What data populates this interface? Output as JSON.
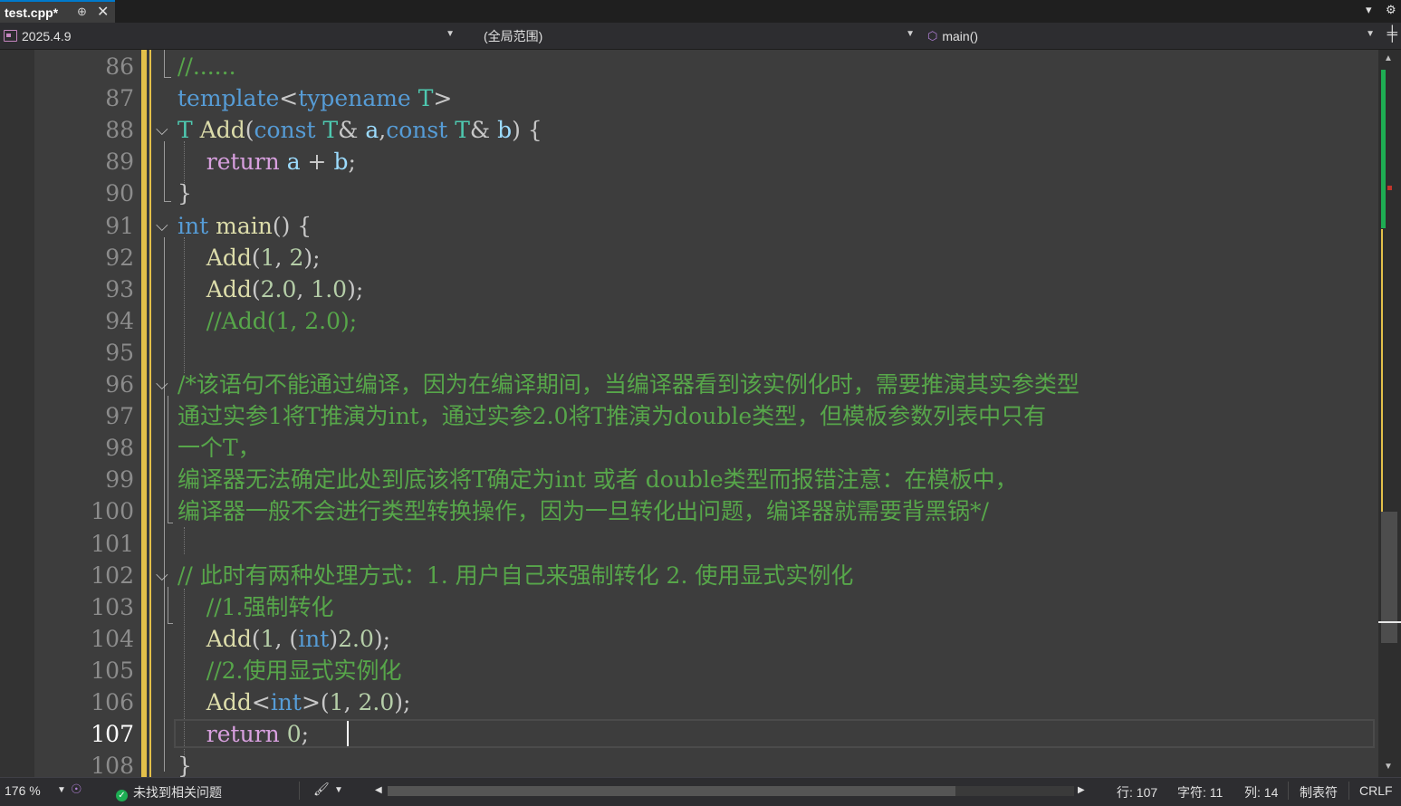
{
  "tab": {
    "title": "test.cpp*",
    "pin": "⊕",
    "close": "✕"
  },
  "navbar": {
    "project": "2025.4.9",
    "scope": "(全局范围)",
    "member": "main()"
  },
  "editor": {
    "current_line": 107,
    "lines": [
      {
        "n": "86",
        "t": [
          [
            "cmt",
            "//......"
          ]
        ]
      },
      {
        "n": "87",
        "t": [
          [
            "kw",
            "template"
          ],
          [
            "pl",
            "<"
          ],
          [
            "kw",
            "typename"
          ],
          [
            "pl",
            " "
          ],
          [
            "ty",
            "T"
          ],
          [
            "pl",
            ">"
          ]
        ]
      },
      {
        "n": "88",
        "fold": true,
        "t": [
          [
            "ty",
            "T"
          ],
          [
            "pl",
            " "
          ],
          [
            "fn",
            "Add"
          ],
          [
            "pl",
            "("
          ],
          [
            "kw",
            "const"
          ],
          [
            "pl",
            " "
          ],
          [
            "ty",
            "T"
          ],
          [
            "pl",
            "& "
          ],
          [
            "var",
            "a"
          ],
          [
            "pl",
            ","
          ],
          [
            "kw",
            "const"
          ],
          [
            "pl",
            " "
          ],
          [
            "ty",
            "T"
          ],
          [
            "pl",
            "& "
          ],
          [
            "var",
            "b"
          ],
          [
            "pl",
            ") {"
          ]
        ]
      },
      {
        "n": "89",
        "t": [
          [
            "pl",
            "    "
          ],
          [
            "ctl",
            "return"
          ],
          [
            "pl",
            " "
          ],
          [
            "var",
            "a"
          ],
          [
            "pl",
            " + "
          ],
          [
            "var",
            "b"
          ],
          [
            "pl",
            ";"
          ]
        ]
      },
      {
        "n": "90",
        "t": [
          [
            "pl",
            "}"
          ]
        ]
      },
      {
        "n": "91",
        "fold": true,
        "t": [
          [
            "kw",
            "int"
          ],
          [
            "pl",
            " "
          ],
          [
            "fn",
            "main"
          ],
          [
            "pl",
            "() {"
          ]
        ]
      },
      {
        "n": "92",
        "t": [
          [
            "pl",
            "    "
          ],
          [
            "fn",
            "Add"
          ],
          [
            "pl",
            "("
          ],
          [
            "num",
            "1"
          ],
          [
            "pl",
            ", "
          ],
          [
            "num",
            "2"
          ],
          [
            "pl",
            ");"
          ]
        ]
      },
      {
        "n": "93",
        "t": [
          [
            "pl",
            "    "
          ],
          [
            "fn",
            "Add"
          ],
          [
            "pl",
            "("
          ],
          [
            "num",
            "2.0"
          ],
          [
            "pl",
            ", "
          ],
          [
            "num",
            "1.0"
          ],
          [
            "pl",
            ");"
          ]
        ]
      },
      {
        "n": "94",
        "t": [
          [
            "pl",
            "    "
          ],
          [
            "cmt",
            "//Add(1, 2.0);"
          ]
        ]
      },
      {
        "n": "95",
        "t": []
      },
      {
        "n": "96",
        "fold": true,
        "t": [
          [
            "cmt",
            "/*该语句不能通过编译，因为在编译期间，当编译器看到该实例化时，需要推演其实参类型"
          ]
        ]
      },
      {
        "n": "97",
        "t": [
          [
            "cmt",
            "通过实参1将T推演为int，通过实参2.0将T推演为double类型，但模板参数列表中只有"
          ]
        ]
      },
      {
        "n": "98",
        "t": [
          [
            "cmt",
            "一个T，"
          ]
        ]
      },
      {
        "n": "99",
        "t": [
          [
            "cmt",
            "编译器无法确定此处到底该将T确定为int 或者 double类型而报错注意：在模板中，"
          ]
        ]
      },
      {
        "n": "100",
        "t": [
          [
            "cmt",
            "编译器一般不会进行类型转换操作，因为一旦转化出问题，编译器就需要背黑锅*/"
          ]
        ]
      },
      {
        "n": "101",
        "t": []
      },
      {
        "n": "102",
        "fold": true,
        "t": [
          [
            "cmt",
            "// 此时有两种处理方式：1. 用户自己来强制转化 2. 使用显式实例化"
          ]
        ]
      },
      {
        "n": "103",
        "t": [
          [
            "pl",
            "    "
          ],
          [
            "cmt",
            "//1.强制转化"
          ]
        ]
      },
      {
        "n": "104",
        "t": [
          [
            "pl",
            "    "
          ],
          [
            "fn",
            "Add"
          ],
          [
            "pl",
            "("
          ],
          [
            "num",
            "1"
          ],
          [
            "pl",
            ", ("
          ],
          [
            "kw",
            "int"
          ],
          [
            "pl",
            ")"
          ],
          [
            "num",
            "2.0"
          ],
          [
            "pl",
            ");"
          ]
        ]
      },
      {
        "n": "105",
        "t": [
          [
            "pl",
            "    "
          ],
          [
            "cmt",
            "//2.使用显式实例化"
          ]
        ]
      },
      {
        "n": "106",
        "t": [
          [
            "pl",
            "    "
          ],
          [
            "fn",
            "Add"
          ],
          [
            "pl",
            "<"
          ],
          [
            "kw",
            "int"
          ],
          [
            "pl",
            ">("
          ],
          [
            "num",
            "1"
          ],
          [
            "pl",
            ", "
          ],
          [
            "num",
            "2.0"
          ],
          [
            "pl",
            ");"
          ]
        ]
      },
      {
        "n": "107",
        "t": [
          [
            "pl",
            "    "
          ],
          [
            "ctl",
            "return"
          ],
          [
            "pl",
            " "
          ],
          [
            "num",
            "0"
          ],
          [
            "pl",
            ";"
          ]
        ]
      },
      {
        "n": "108",
        "t": [
          [
            "pl",
            "}"
          ]
        ]
      }
    ]
  },
  "statusbar": {
    "zoom": "176 %",
    "issues": "未找到相关问题",
    "line": "行: 107",
    "char": "字符: 11",
    "col": "列: 14",
    "tabs": "制表符",
    "eol": "CRLF"
  },
  "colors": {
    "keyword": "#569cd6",
    "type": "#4ec9b0",
    "function": "#dcdcaa",
    "comment": "#57a64a",
    "control": "#d8a0df",
    "number": "#b5cea8",
    "change_marker": "#e3c04a",
    "accent": "#007acc"
  }
}
